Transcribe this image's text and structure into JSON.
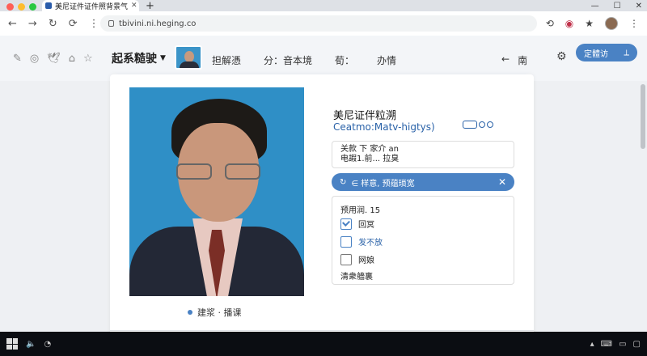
{
  "browser": {
    "tab_title": "美尼证件证件照背景气",
    "url": "tbivini.ni.heging.co"
  },
  "appbar": {
    "brand": "起系糙驶",
    "nav": [
      "担解憑",
      "分：音本境",
      "荀：",
      "办情"
    ],
    "back_label": "南",
    "cta_label": "定體访"
  },
  "content": {
    "title": "美尼证伴粒溯",
    "subtitle": "Ceatmo:Matv-higtys)",
    "info_lines": [
      "关款 下 家介 an",
      "电嘏1.前... 拉臭"
    ],
    "alert_text": "∈ 样意, 预蕴琐宽",
    "panel_heading": "预用润. 15",
    "options": [
      {
        "label": "回冥",
        "checked": true
      },
      {
        "label": "发不放",
        "checked": false
      },
      {
        "label": "网娘",
        "checked": false
      }
    ],
    "panel_footer": "清衆艢裏",
    "photo_caption": "建浆 · 播课"
  },
  "colors": {
    "accent": "#4a82c4",
    "photo_bg": "#2f8fc6"
  }
}
